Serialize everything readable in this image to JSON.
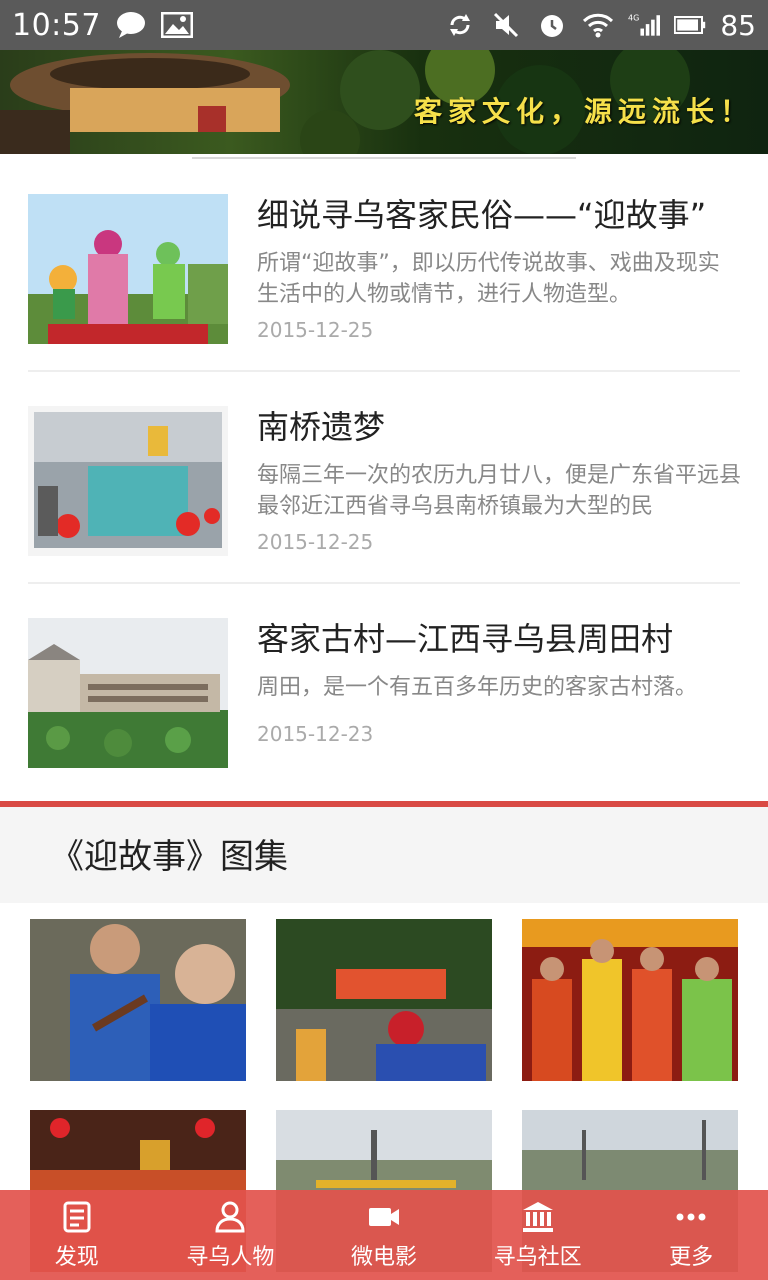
{
  "status_bar": {
    "time": "10:57",
    "battery": "85",
    "network": "4G"
  },
  "banner": {
    "slogan": "客家文化，源远流长！"
  },
  "news": [
    {
      "title": "细说寻乌客家民俗——“迎故事”",
      "summary": "所谓“迎故事”，即以历代传说故事、戏曲及现实生活中的人物或情节，进行人物造型。",
      "date": "2015-12-25"
    },
    {
      "title": "南桥遗梦",
      "summary": "每隔三年一次的农历九月廿八，便是广东省平远县最邻近江西省寻乌县南桥镇最为大型的民",
      "date": "2015-12-25"
    },
    {
      "title": "客家古村—江西寻乌县周田村",
      "summary": "周田，是一个有五百多年历史的客家古村落。",
      "date": "2015-12-23"
    }
  ],
  "gallery": {
    "title": "《迎故事》图集"
  },
  "bottom_nav": [
    {
      "label": "发现",
      "icon": "discover-icon"
    },
    {
      "label": "寻乌人物",
      "icon": "person-icon"
    },
    {
      "label": "微电影",
      "icon": "video-camera-icon"
    },
    {
      "label": "寻乌社区",
      "icon": "community-building-icon"
    },
    {
      "label": "更多",
      "icon": "more-dots-icon"
    }
  ],
  "colors": {
    "accent": "#d94a44",
    "status_bar": "#5a5a5a"
  }
}
